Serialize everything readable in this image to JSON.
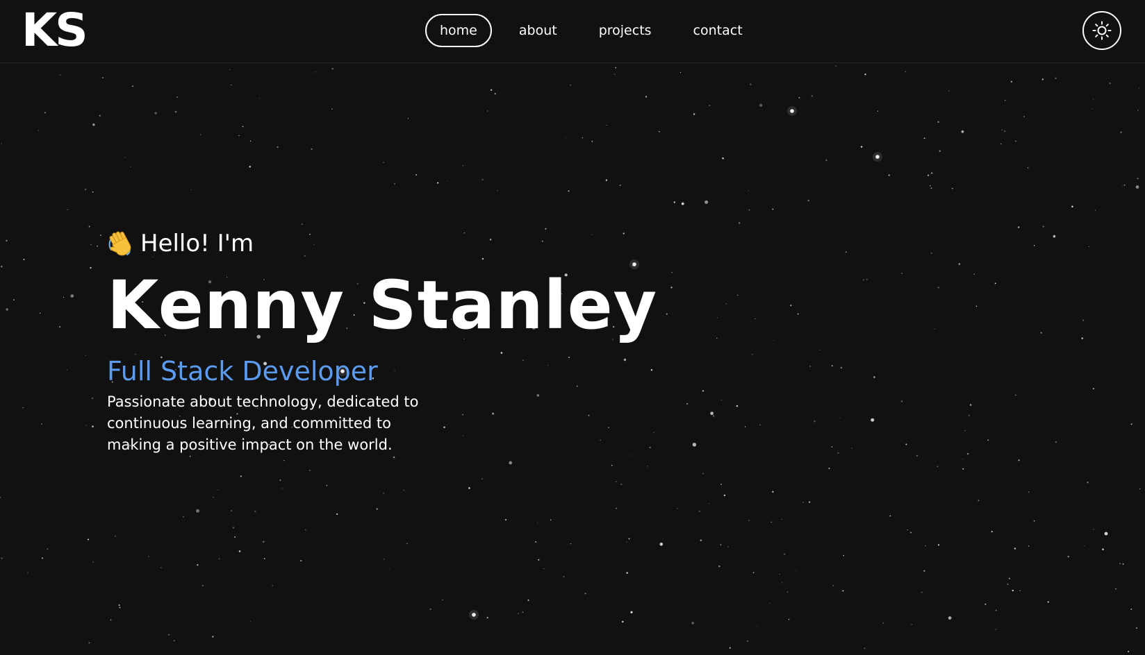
{
  "header": {
    "logo": "KS",
    "nav": [
      {
        "label": "home",
        "active": true
      },
      {
        "label": "about",
        "active": false
      },
      {
        "label": "projects",
        "active": false
      },
      {
        "label": "contact",
        "active": false
      }
    ],
    "theme_toggle_icon": "sun-icon"
  },
  "hero": {
    "greeting_icon": "waving-hand-icon",
    "greeting": "Hello! I'm",
    "name": "Kenny Stanley",
    "role": "Full Stack Developer",
    "bio": "Passionate about technology, dedicated to continuous learning, and committed to making a positive impact on the world."
  },
  "colors": {
    "background": "#111111",
    "text": "#ffffff",
    "accent": "#5b9bf0"
  }
}
